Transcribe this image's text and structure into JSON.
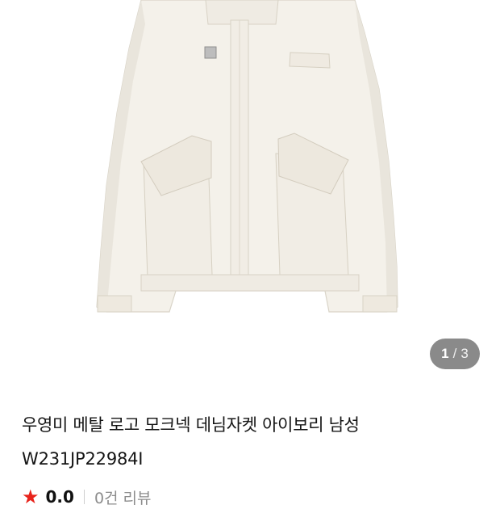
{
  "product": {
    "image_alt_icon": "jacket-image",
    "pager": {
      "current": "1",
      "separator": "/",
      "total": "3"
    },
    "title": "우영미 메탈 로고 모크넥 데님자켓 아이보리 남성",
    "code": "W231JP22984I",
    "rating": {
      "star_icon": "star-icon",
      "score": "0.0",
      "reviews": "0건 리뷰"
    }
  },
  "colors": {
    "star": "#e8231b",
    "pager_bg": "#8a8a8a",
    "jacket": "#f4f1ea"
  }
}
